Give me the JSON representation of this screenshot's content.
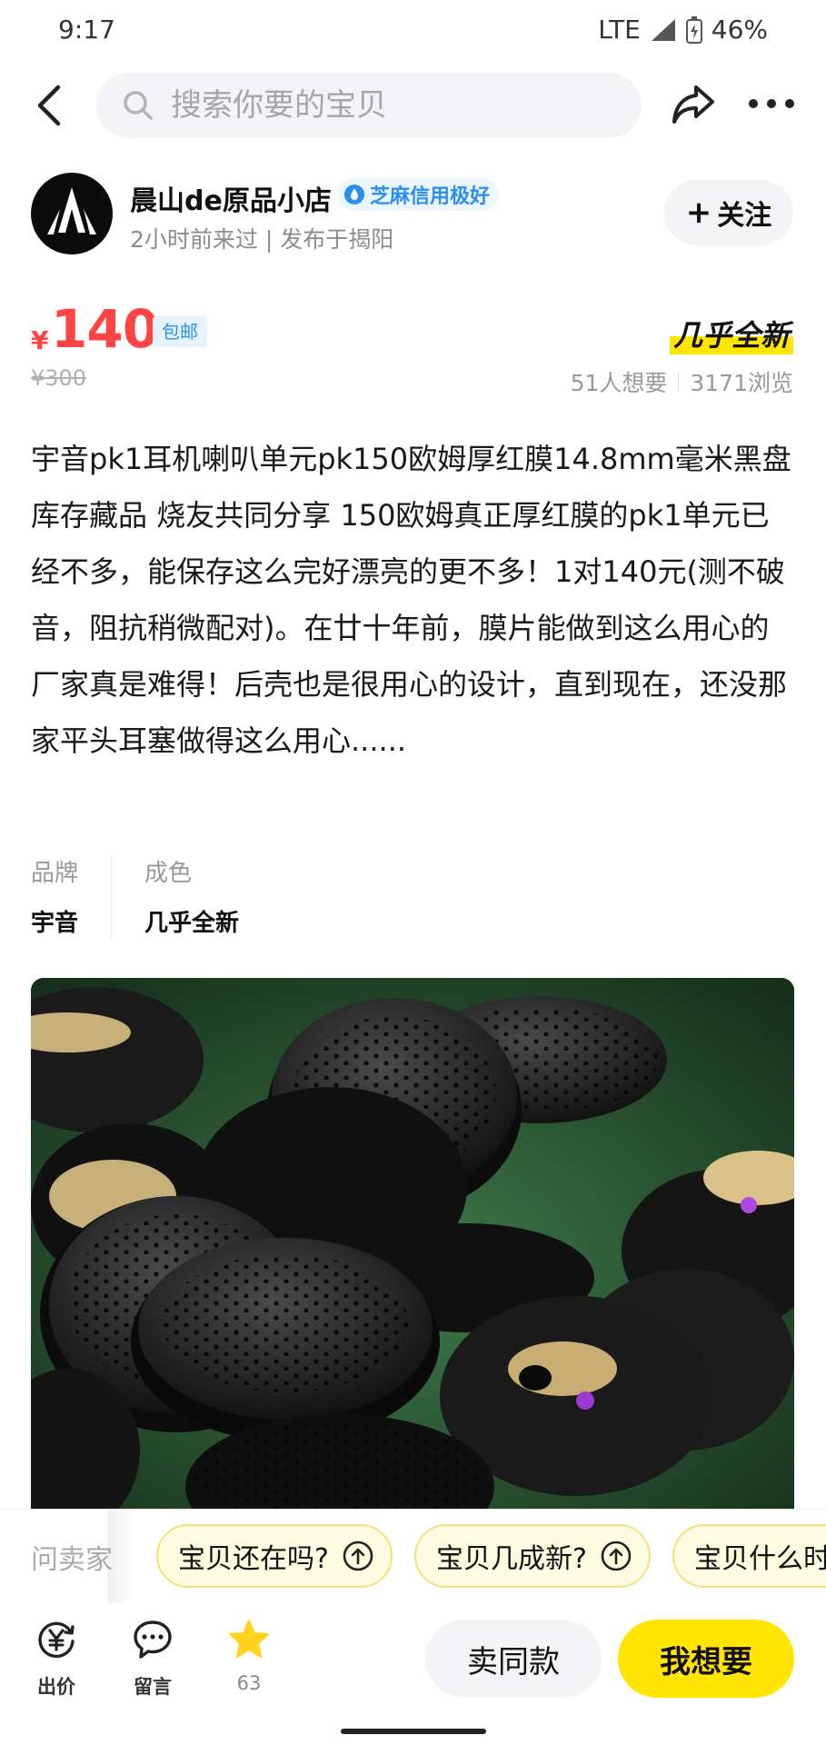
{
  "status_bar": {
    "time": "9:17",
    "network": "LTE",
    "battery": "46%"
  },
  "search": {
    "placeholder": "搜索你要的宝贝"
  },
  "seller": {
    "name": "晨山de原品小店",
    "credit_badge": "芝麻信用极好",
    "meta": "2小时前来过 | 发布于揭阳",
    "follow_label": "关注"
  },
  "item": {
    "currency": "¥",
    "price": "140",
    "shipping_tag": "包邮",
    "original_price": "¥300",
    "condition": "几乎全新",
    "wants": "51人想要",
    "views": "3171浏览",
    "description": "宇音pk1耳机喇叭单元pk150欧姆厚红膜14.8mm毫米黑盘 库存藏品 烧友共同分享 150欧姆真正厚红膜的pk1单元已经不多，能保存这么完好漂亮的更不多！1对140元(测不破音，阻抗稍微配对)。在廿十年前，膜片能做到这么用心的厂家真是难得！后壳也是很用心的设计，直到现在，还没那家平头耳塞做得这么用心......"
  },
  "attributes": [
    {
      "label": "品牌",
      "value": "宇音"
    },
    {
      "label": "成色",
      "value": "几乎全新"
    }
  ],
  "questions": {
    "label": "问卖家",
    "chips": [
      "宝贝还在吗?",
      "宝贝几成新?",
      "宝贝什么时"
    ]
  },
  "bottom_bar": {
    "offer_label": "出价",
    "comment_label": "留言",
    "favorite_count": "63",
    "same_label": "卖同款",
    "want_label": "我想要"
  },
  "colors": {
    "price": "#ff4444",
    "accent_yellow": "#ffe500",
    "credit_blue": "#2a8ff0"
  },
  "icons": [
    "back-arrow-icon",
    "search-icon",
    "share-icon",
    "more-icon",
    "sesame-drop-icon",
    "plus-icon",
    "arrow-up-circle-icon",
    "yen-icon",
    "chat-bubble-icon",
    "star-icon"
  ]
}
